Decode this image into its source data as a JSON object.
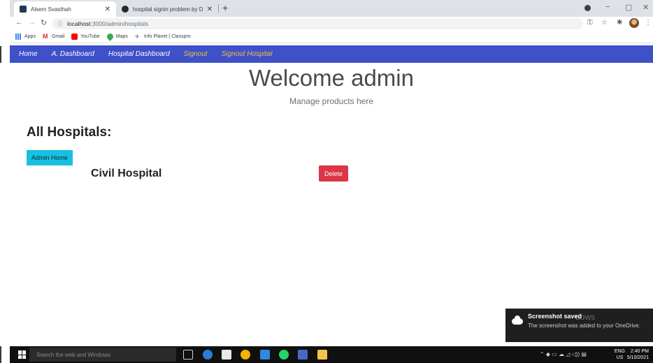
{
  "browser": {
    "tabs": [
      {
        "title": "Alsem Svasthah",
        "active": true
      },
      {
        "title": "hospital signin problem by Dhin",
        "active": false
      }
    ],
    "new_tab": "+",
    "window_controls": {
      "minimize": "−",
      "maximize": "▢",
      "close": "✕"
    },
    "address": {
      "host": "localhost",
      "path": ":3000/admin/hospitals"
    },
    "bookmarks": [
      "Apps",
      "Gmail",
      "YouTube",
      "Maps",
      "Info Planet | Classpro"
    ]
  },
  "navbar": {
    "items": [
      {
        "label": "Home",
        "color": "#ffffff"
      },
      {
        "label": "A. Dashboard",
        "color": "#ffffff"
      },
      {
        "label": "Hospital Dashboard",
        "color": "#ffffff"
      },
      {
        "label": "Signout",
        "color": "#f0c040"
      },
      {
        "label": "Signout Hospital",
        "color": "#f0c040"
      }
    ],
    "background": "#3f51c9"
  },
  "page": {
    "title": "Welcome admin",
    "subtitle": "Manage products here",
    "section_title": "All Hospitals:",
    "admin_home_label": "Admin Home",
    "hospitals": [
      {
        "name": "Civil Hospital",
        "delete_label": "Delete"
      }
    ]
  },
  "toast": {
    "title": "Screenshot saved",
    "body": "The screenshot was added to your OneDrive.",
    "ghost_text": "dows"
  },
  "taskbar": {
    "search_placeholder": "Search the web and Windows",
    "lang_top": "ENG",
    "lang_bottom": "US",
    "time": "2:40 PM",
    "date": "5/10/2021"
  },
  "colors": {
    "info_button": "#17c0e0",
    "danger_button": "#dc3545"
  }
}
